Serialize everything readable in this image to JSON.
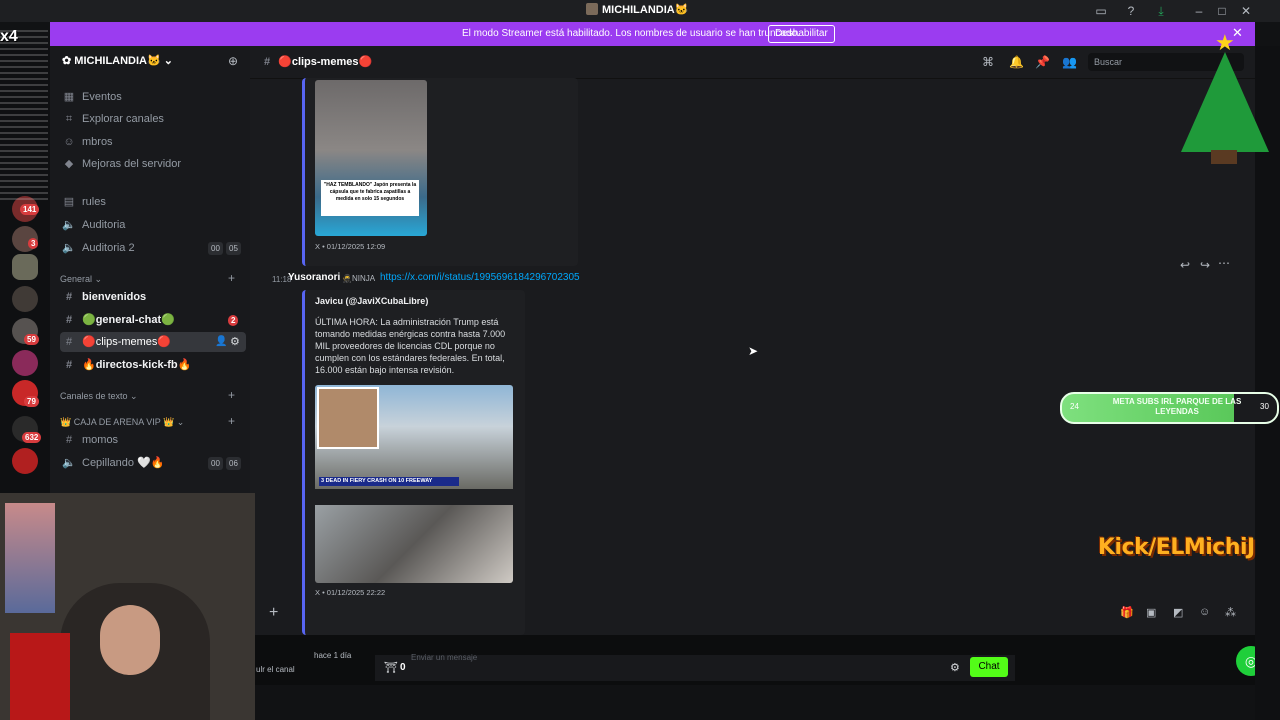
{
  "window": {
    "title": "MICHILANDIA🐱",
    "buttons": [
      "inbox-icon",
      "help-icon",
      "download-icon",
      "minimize",
      "maximize",
      "close"
    ]
  },
  "banner": {
    "message": "El modo Streamer está habilitado. Los nombres de usuario se han truncado.",
    "button": "Deshabilitar",
    "color": "#9b3cf0"
  },
  "server_rail": {
    "badges": [
      "141",
      "3",
      "59",
      "79",
      "632"
    ]
  },
  "sidebar": {
    "server_name": "MICHILANDIA🐱",
    "top_items": [
      {
        "label": "Eventos"
      },
      {
        "label": "Explorar canales"
      },
      {
        "label": "mbros"
      },
      {
        "label": "Mejoras del servidor"
      }
    ],
    "channels_top": [
      {
        "label": "rules",
        "icon": "rules-icon"
      },
      {
        "label": "Auditoria",
        "icon": "speaker-icon"
      },
      {
        "label": "Auditoria 2",
        "icon": "speaker-icon",
        "count_a": "00",
        "count_b": "05"
      }
    ],
    "category_general": "General",
    "channels_general": [
      {
        "label": "bienvenidos"
      },
      {
        "label": "🟢general-chat🟢",
        "badge": "2"
      },
      {
        "label": "🔴clips-memes🔴"
      },
      {
        "label": "🔥directos-kick-fb🔥"
      }
    ],
    "category_text": "Canales de texto",
    "category_vip": "👑 CAJA DE ARENA VIP 👑",
    "channels_vip": [
      {
        "label": "momos"
      },
      {
        "label": "Cepillando 🤍🔥",
        "count_a": "00",
        "count_b": "06"
      }
    ]
  },
  "header": {
    "channel": "🔴clips-memes🔴",
    "search_placeholder": "Buscar"
  },
  "messages": [
    {
      "embed_image_caption": "\"HAZ TEMBLANDO\" Japón presenta la cápsula que te fabrica zapatillas a medida en solo 15 segundos",
      "footer": "X • 01/12/2025 12:09"
    },
    {
      "time": "11:18",
      "author": "Yusoranori",
      "role_tag": "🥷NINJA",
      "link": "https://x.com/i/status/1995696184296702305",
      "embed_author": "Javicu (@JaviXCubaLibre)",
      "embed_text": "ÚLTIMA HORA: La administración Trump está tomando medidas enérgicas contra hasta 7.000 MIL proveedores de licencias CDL porque no cumplen con los estándares federales. En total, 16.000 están bajo intensa revisión.",
      "news_headline": "3 DEAD IN FIERY CRASH ON 10 FREEWAY",
      "footer": "X • 01/12/2025 22:22"
    }
  ],
  "bottom": {
    "chat_placeholder": "Enviar un mensaje",
    "points": "0",
    "chat_button": "Chat",
    "left_ago": "hace 1 día",
    "left_channel": "ulr el canal"
  },
  "overlays": {
    "goal_text": "META SUBS IRL PARQUE DE LAS LEYENDAS",
    "goal_left": "24",
    "goal_right": "30",
    "kick_handle": "Kick/ELMichiJ"
  }
}
